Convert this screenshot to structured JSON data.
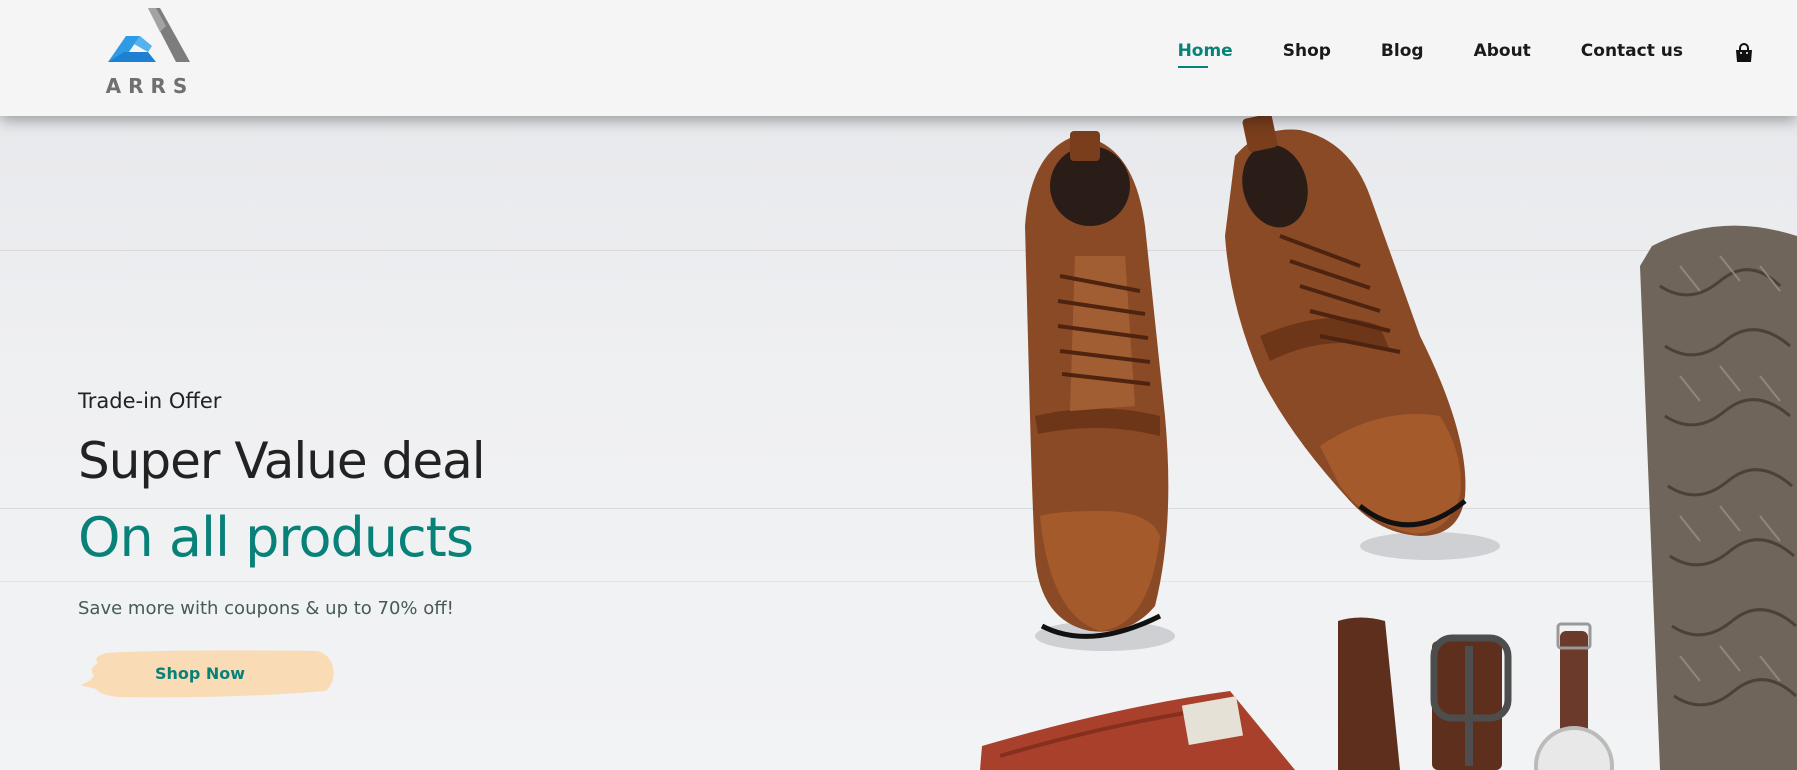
{
  "brand": {
    "logo_text": "ARRS",
    "colors": {
      "accent": "#088178",
      "logo_blue": "#2f9be6",
      "logo_gray": "#808080"
    }
  },
  "nav": {
    "items": [
      {
        "label": "Home",
        "active": true
      },
      {
        "label": "Shop",
        "active": false
      },
      {
        "label": "Blog",
        "active": false
      },
      {
        "label": "About",
        "active": false
      },
      {
        "label": "Contact us",
        "active": false
      }
    ],
    "cart_icon": "shopping-bag-icon"
  },
  "hero": {
    "tag": "Trade-in Offer",
    "headline": "Super Value deal",
    "highlight": "On all products",
    "subtext": "Save more with coupons & up to 70% off!",
    "button_label": "Shop Now",
    "image": "boots-belt-watch-sweater-image"
  }
}
